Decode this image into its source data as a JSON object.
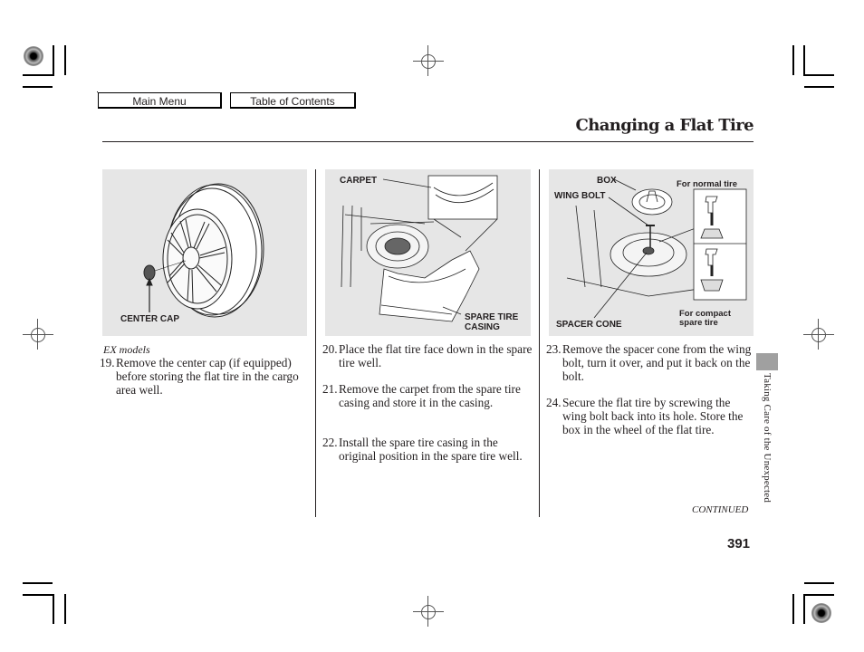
{
  "nav": {
    "main_menu": "Main Menu",
    "table_of_contents": "Table of Contents"
  },
  "header": {
    "title": "Changing a Flat Tire"
  },
  "figures": {
    "fig1": {
      "labels": {
        "center_cap": "CENTER CAP"
      }
    },
    "fig2": {
      "labels": {
        "carpet": "CARPET",
        "spare_tire_casing_1": "SPARE TIRE",
        "spare_tire_casing_2": "CASING"
      }
    },
    "fig3": {
      "labels": {
        "box": "BOX",
        "wing_bolt": "WING BOLT",
        "spacer_cone": "SPACER CONE",
        "for_normal_tire": "For normal tire",
        "for_compact_1": "For compact",
        "for_compact_2": "spare tire"
      }
    }
  },
  "content": {
    "col1": {
      "note": "EX models",
      "steps": [
        {
          "num": "19.",
          "text": "Remove the center cap (if equipped) before storing the flat tire in the cargo area well."
        }
      ]
    },
    "col2": {
      "steps": [
        {
          "num": "20.",
          "text": "Place the flat tire face down in the spare tire well."
        },
        {
          "num": "21.",
          "text": "Remove the carpet from the spare tire casing and store it in the casing."
        },
        {
          "num": "22.",
          "text": "Install the spare tire casing in the original position in the spare tire well."
        }
      ]
    },
    "col3": {
      "steps": [
        {
          "num": "23.",
          "text": "Remove the spacer cone from the wing bolt, turn it over, and put it back on the bolt."
        },
        {
          "num": "24.",
          "text": "Secure the flat tire by screwing the wing bolt back into its hole. Store the box in the wheel of the flat tire."
        }
      ]
    }
  },
  "footer": {
    "continued": "CONTINUED",
    "page_number": "391",
    "section_tab": "Taking Care of the Unexpected"
  },
  "icons": {
    "registration_target": "crosshair-circle",
    "color_target": "radial-target"
  },
  "colors": {
    "figure_background": "#e6e6e6",
    "section_tab": "#a0a0a0",
    "text": "#231f20"
  }
}
